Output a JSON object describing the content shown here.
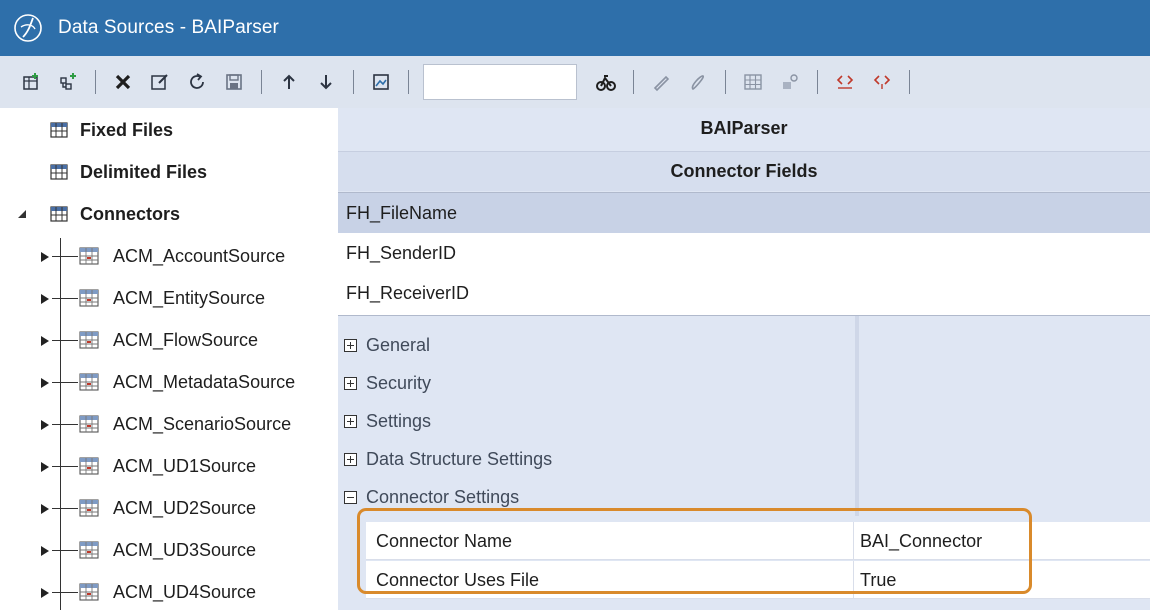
{
  "window": {
    "title": "Data Sources - BAIParser"
  },
  "toolbar": {
    "search": {
      "value": "",
      "placeholder": ""
    },
    "buttons": [
      "add-fixed-file-icon",
      "add-connector-icon",
      "delete-icon",
      "rename-icon",
      "refresh-icon",
      "save-icon",
      "move-up-icon",
      "move-down-icon",
      "view-icon",
      "search-go-icon",
      "edit-icon",
      "edit-disabled-icon",
      "grid-icon",
      "assign-icon",
      "code-icon",
      "code-alt-icon"
    ]
  },
  "tree": {
    "roots": [
      {
        "label": "Fixed Files"
      },
      {
        "label": "Delimited Files"
      },
      {
        "label": "Connectors"
      }
    ],
    "connectors": [
      "ACM_AccountSource",
      "ACM_EntitySource",
      "ACM_FlowSource",
      "ACM_MetadataSource",
      "ACM_ScenarioSource",
      "ACM_UD1Source",
      "ACM_UD2Source",
      "ACM_UD3Source",
      "ACM_UD4Source"
    ]
  },
  "panel": {
    "title": "BAIParser",
    "subtitle": "Connector Fields",
    "fields": [
      "FH_FileName",
      "FH_SenderID",
      "FH_ReceiverID"
    ],
    "categories": [
      {
        "label": "General",
        "state": "collapsed"
      },
      {
        "label": "Security",
        "state": "collapsed"
      },
      {
        "label": "Settings",
        "state": "collapsed"
      },
      {
        "label": "Data Structure Settings",
        "state": "collapsed"
      },
      {
        "label": "Connector Settings",
        "state": "expanded"
      }
    ],
    "properties": [
      {
        "name": "Connector Name",
        "value": "BAI_Connector"
      },
      {
        "name": "Connector Uses File",
        "value": "True"
      }
    ]
  },
  "colors": {
    "titlebar": "#2e6faa",
    "toolbar": "#dde4ef",
    "panel": "#dfe6f3",
    "highlight": "#d98a2b"
  }
}
